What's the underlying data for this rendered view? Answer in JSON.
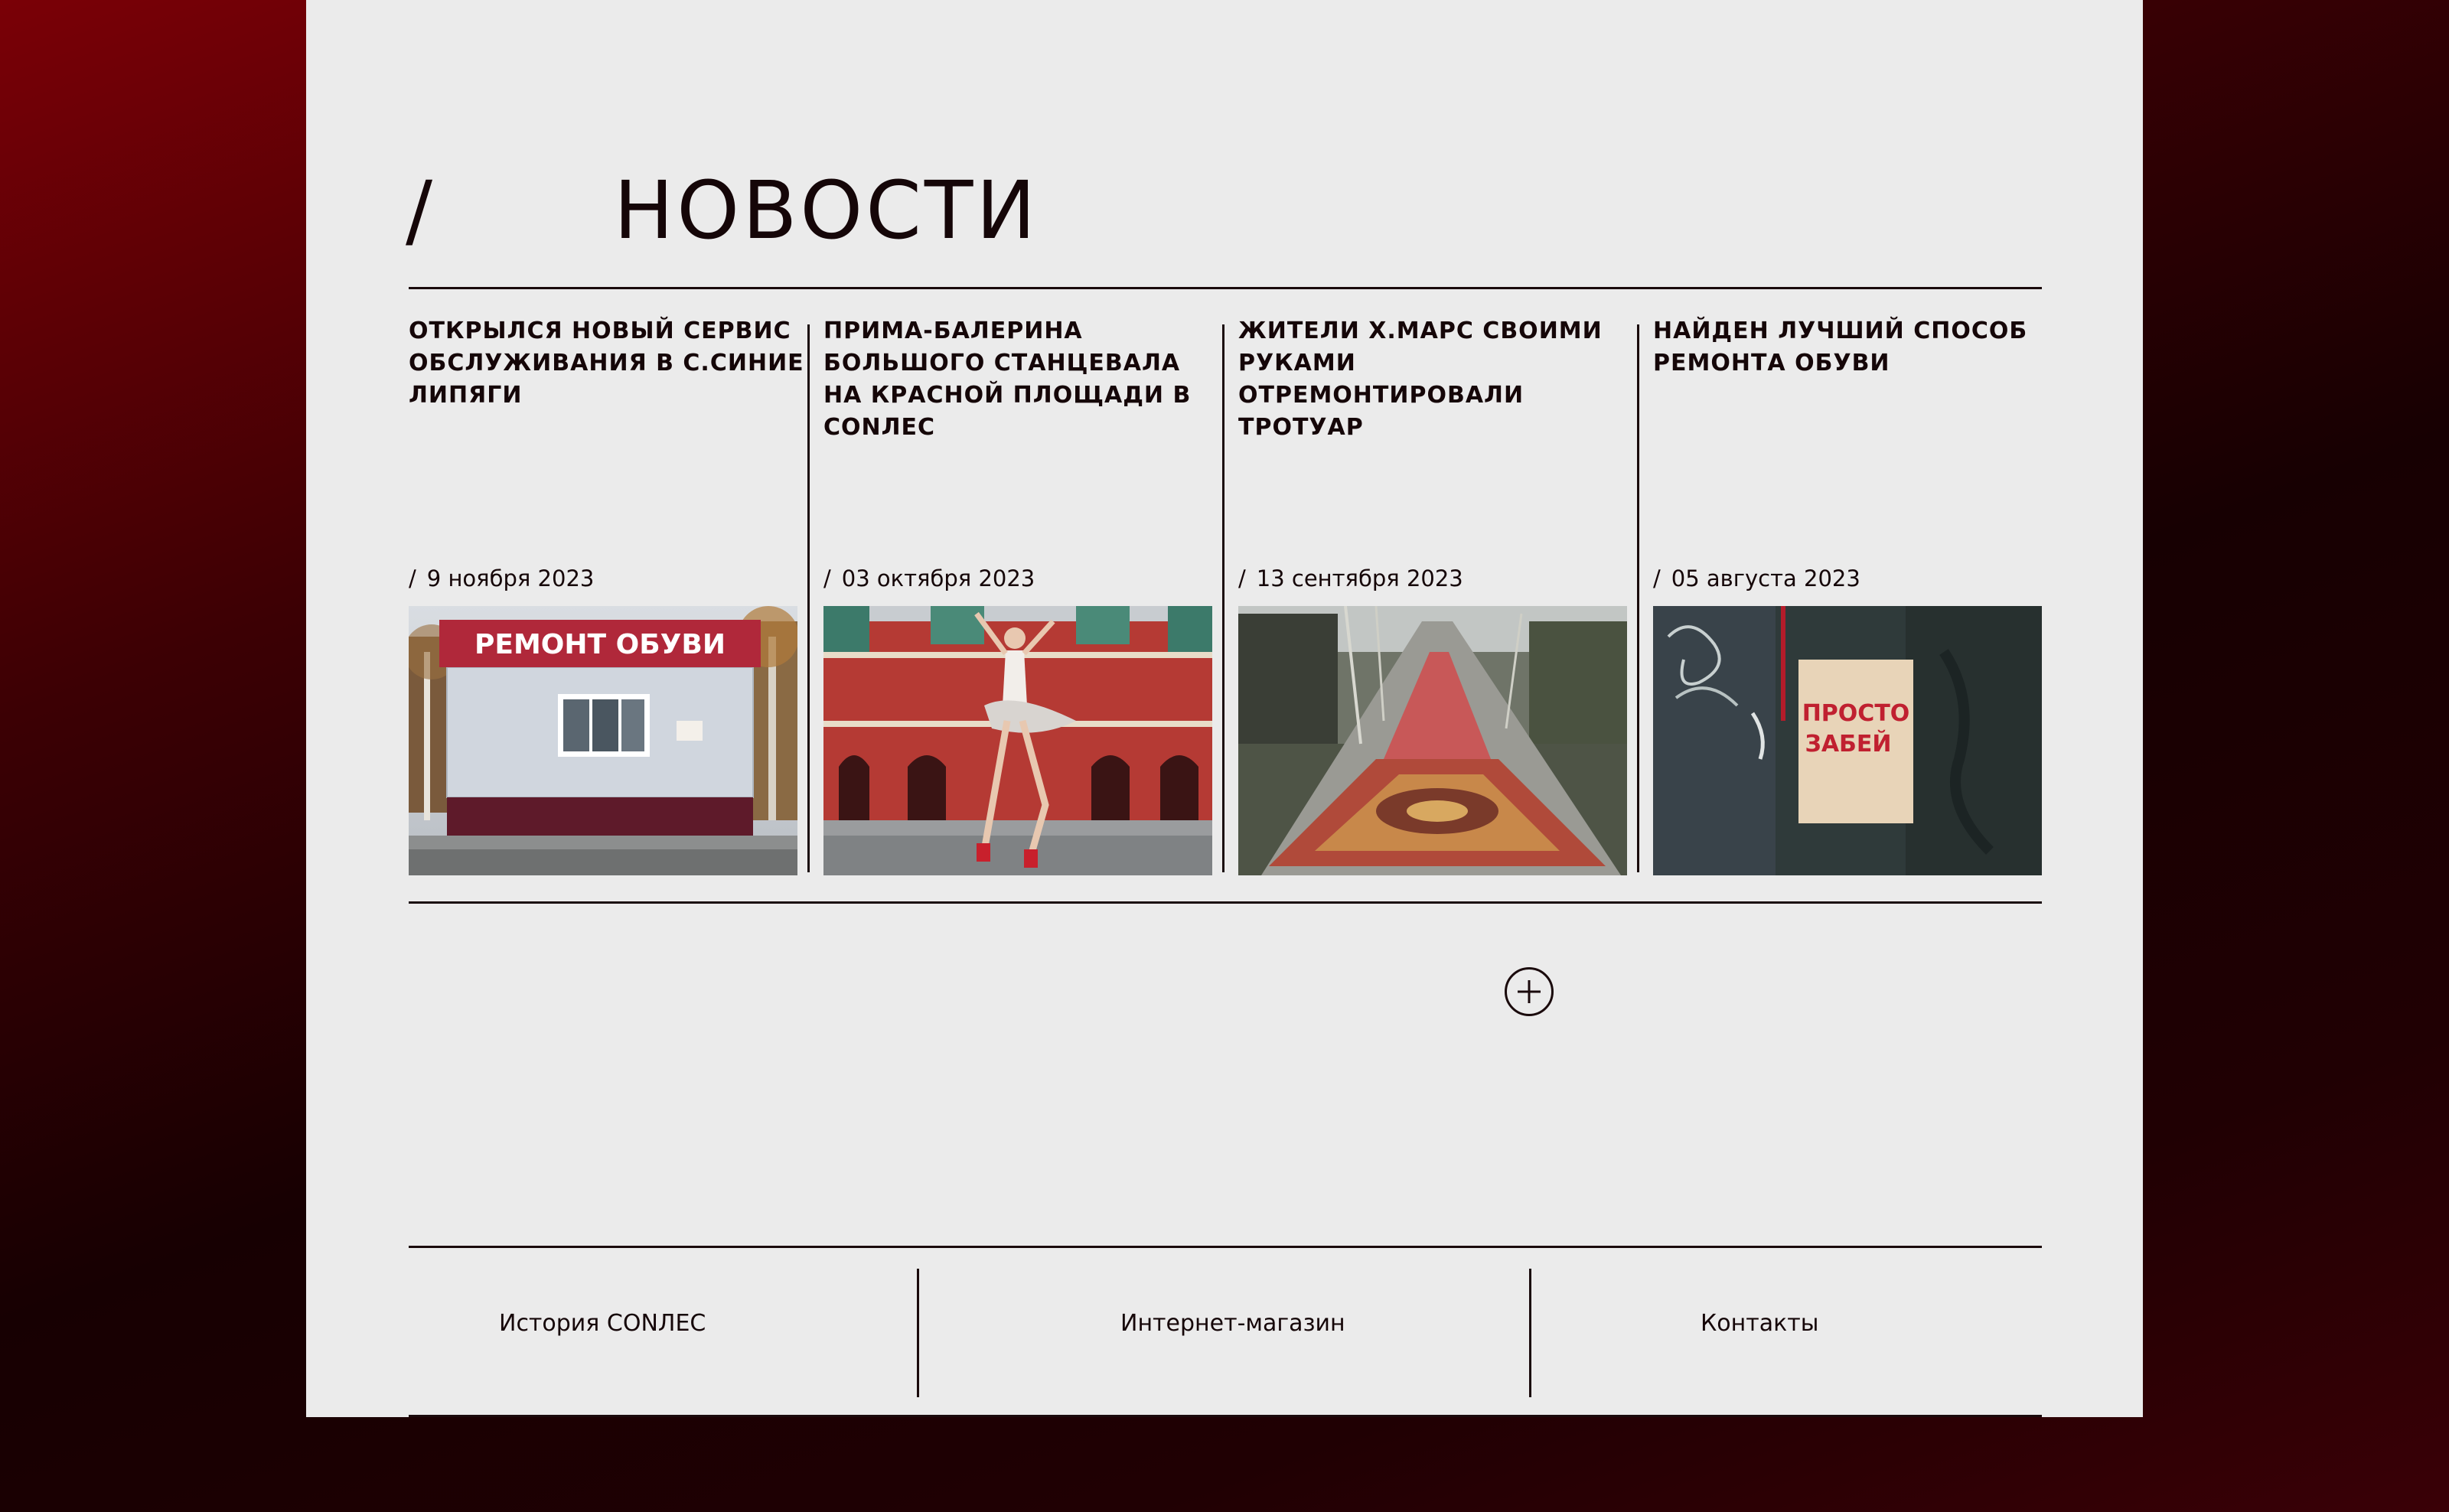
{
  "section": {
    "slash": "/",
    "title": "НОВОСТИ"
  },
  "news": [
    {
      "title": "ОТКРЫЛСЯ НОВЫЙ СЕРВИС ОБСЛУЖИВАНИЯ В С.СИНИЕ ЛИПЯГИ",
      "date_slash": "/",
      "date": "9 ноября 2023",
      "image_sign": "РЕМОНТ ОБУВИ"
    },
    {
      "title": "ПРИМА-БАЛЕРИНА БОЛЬШОГО СТАНЦЕВАЛА НА КРАСНОЙ ПЛОЩАДИ В CONЛЕС",
      "date_slash": "/",
      "date": "03 октября 2023"
    },
    {
      "title": "ЖИТЕЛИ Х.МАРС СВОИМИ РУКАМИ ОТРЕМОНТИРОВАЛИ ТРОТУАР",
      "date_slash": "/",
      "date": "13 сентября 2023"
    },
    {
      "title": "НАЙДЕН ЛУЧШИЙ СПОСОБ РЕМОНТА ОБУВИ",
      "date_slash": "/",
      "date": "05 августа 2023",
      "image_poster_line1": "ПРОСТО",
      "image_poster_line2": "ЗАБЕЙ"
    }
  ],
  "load_more": {
    "icon": "plus-circle-icon"
  },
  "footer": {
    "links": [
      {
        "label": "История CONЛЕС"
      },
      {
        "label": "Интернет-магазин"
      },
      {
        "label": "Контакты"
      }
    ]
  },
  "colors": {
    "panel_bg": "#ebebeb",
    "text": "#150608",
    "background_red": "#7a0006",
    "background_dark": "#170002"
  }
}
